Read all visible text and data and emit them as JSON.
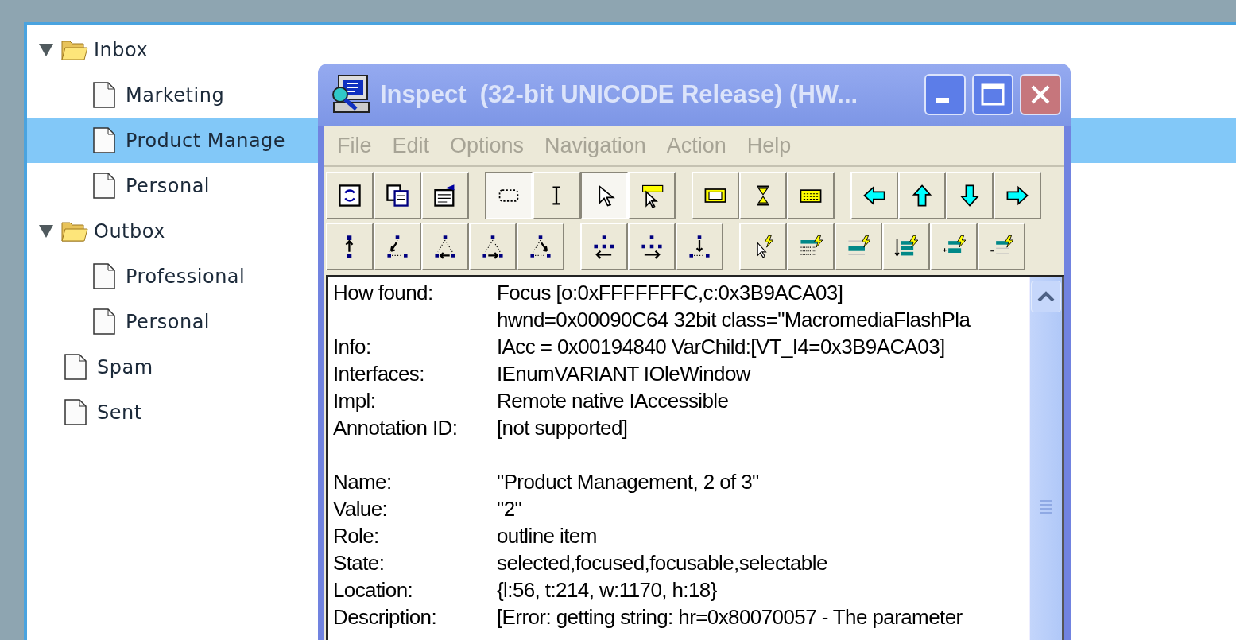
{
  "tree": [
    {
      "label": "Inbox",
      "kind": "folder",
      "expanded": true,
      "selected": false,
      "children": [
        {
          "label": "Marketing",
          "kind": "page",
          "selected": false
        },
        {
          "label": "Product Manage",
          "kind": "page",
          "selected": true
        },
        {
          "label": "Personal",
          "kind": "page",
          "selected": false
        }
      ]
    },
    {
      "label": "Outbox",
      "kind": "folder",
      "expanded": true,
      "selected": false,
      "children": [
        {
          "label": "Professional",
          "kind": "page",
          "selected": false
        },
        {
          "label": "Personal",
          "kind": "page",
          "selected": false
        }
      ]
    },
    {
      "label": "Spam",
      "kind": "page",
      "selected": false
    },
    {
      "label": "Sent",
      "kind": "page",
      "selected": false
    }
  ],
  "window": {
    "title": "Inspect  (32-bit UNICODE Release) (HW...",
    "menu": [
      {
        "label": "File",
        "disabled": true
      },
      {
        "label": "Edit",
        "disabled": true
      },
      {
        "label": "Options",
        "disabled": true
      },
      {
        "label": "Navigation",
        "disabled": true
      },
      {
        "label": "Action",
        "disabled": true
      },
      {
        "label": "Help",
        "disabled": true
      }
    ],
    "toolbar_rows": [
      [
        [
          {
            "kind": "refresh",
            "selected": false
          },
          {
            "kind": "copy",
            "selected": false
          },
          {
            "kind": "properties",
            "selected": false
          }
        ],
        [
          {
            "kind": "rect-select",
            "selected": true
          },
          {
            "kind": "ibeam",
            "selected": false
          },
          {
            "kind": "pointer",
            "selected": true
          },
          {
            "kind": "tooltip-pointer",
            "selected": false
          }
        ],
        [
          {
            "kind": "highlight",
            "selected": false
          },
          {
            "kind": "hourglass",
            "selected": false
          },
          {
            "kind": "keyboard",
            "selected": false
          }
        ],
        [
          {
            "kind": "left",
            "selected": false
          },
          {
            "kind": "up",
            "selected": false
          },
          {
            "kind": "down",
            "selected": false
          },
          {
            "kind": "right",
            "selected": false
          }
        ]
      ],
      [
        [
          {
            "kind": "nav-parent",
            "selected": false
          },
          {
            "kind": "nav-tri-a",
            "selected": false
          },
          {
            "kind": "nav-tri-b",
            "selected": false
          },
          {
            "kind": "nav-tri-c",
            "selected": false
          },
          {
            "kind": "nav-tri-d",
            "selected": false
          }
        ],
        [
          {
            "kind": "nav-nodes-left",
            "selected": false
          },
          {
            "kind": "nav-nodes-right",
            "selected": false
          },
          {
            "kind": "nav-nodes-down",
            "selected": false
          }
        ],
        [
          {
            "kind": "event-pointer",
            "selected": false
          },
          {
            "kind": "event-list",
            "selected": false
          },
          {
            "kind": "event-add",
            "selected": false
          },
          {
            "kind": "event-sort",
            "selected": false
          },
          {
            "kind": "event-plus",
            "selected": false
          },
          {
            "kind": "event-minus",
            "selected": false
          }
        ]
      ]
    ],
    "property_groups": [
      [
        {
          "label": "How found:",
          "lines": [
            "Focus [o:0xFFFFFFFC,c:0x3B9ACA03]",
            "hwnd=0x00090C64 32bit class=\"MacromediaFlashPla"
          ]
        },
        {
          "label": "Info:",
          "lines": [
            "IAcc = 0x00194840 VarChild:[VT_I4=0x3B9ACA03]"
          ]
        },
        {
          "label": "Interfaces:",
          "lines": [
            "IEnumVARIANT IOleWindow"
          ]
        },
        {
          "label": "Impl:",
          "lines": [
            "Remote native IAccessible"
          ]
        },
        {
          "label": "Annotation ID:",
          "lines": [
            "[not supported]"
          ]
        }
      ],
      [
        {
          "label": "Name:",
          "lines": [
            "\"Product Management, 2 of 3\""
          ]
        },
        {
          "label": "Value:",
          "lines": [
            "\"2\""
          ]
        },
        {
          "label": "Role:",
          "lines": [
            "outline item"
          ]
        },
        {
          "label": "State:",
          "lines": [
            "selected,focused,focusable,selectable"
          ]
        },
        {
          "label": "Location:",
          "lines": [
            "{l:56, t:214, w:1170, h:18}"
          ]
        },
        {
          "label": "Description:",
          "lines": [
            "[Error: getting string: hr=0x80070057 - The parameter"
          ]
        }
      ]
    ]
  }
}
